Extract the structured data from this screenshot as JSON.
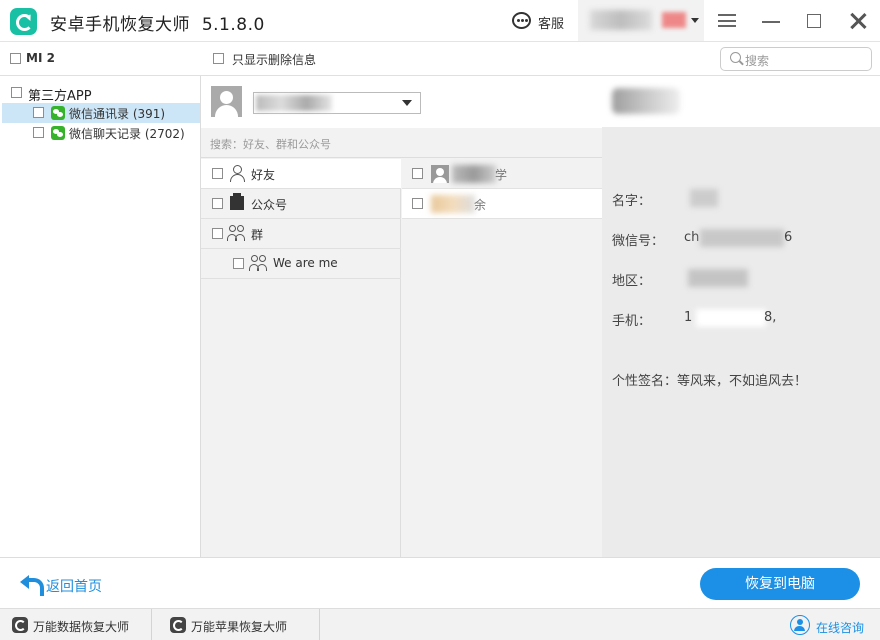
{
  "app": {
    "title": "安卓手机恢复大师",
    "version": "5.1.8.0",
    "support_label": "客服"
  },
  "toolbar": {
    "device_label": "MI 2",
    "filter_label": "只显示删除信息",
    "search_placeholder": "搜索"
  },
  "tree": {
    "root_label": "第三方APP",
    "items": [
      {
        "label": "微信通讯录 (391)",
        "selected": true
      },
      {
        "label": "微信聊天记录 (2702)",
        "selected": false
      }
    ]
  },
  "contacts": {
    "search_hint": "搜索：好友、群和公众号",
    "categories": [
      {
        "label": "好友",
        "icon": "person-icon"
      },
      {
        "label": "公众号",
        "icon": "official-account-icon"
      },
      {
        "label": "群",
        "icon": "group-icon"
      },
      {
        "label": "We are me",
        "icon": "group-icon"
      }
    ],
    "entries": [
      {
        "suffix": "学"
      },
      {
        "suffix": "余"
      }
    ]
  },
  "detail": {
    "name_key": "名字：",
    "wechat_key": "微信号：",
    "wechat_prefix": "ch",
    "wechat_suffix": "6",
    "region_key": "地区：",
    "phone_key": "手机：",
    "phone_prefix": "1",
    "phone_suffix": "8,",
    "signature": "个性签名：等风来，不如追风去！"
  },
  "footer": {
    "back_label": "返回首页",
    "restore_label": "恢复到电脑"
  },
  "statusbar": {
    "item1": "万能数据恢复大师",
    "item2": "万能苹果恢复大师",
    "online_label": "在线咨询"
  },
  "colors": {
    "accent": "#1b90e6",
    "logo": "#1ac0a4",
    "wechat": "#36b22c",
    "selection": "#cde6f7"
  }
}
